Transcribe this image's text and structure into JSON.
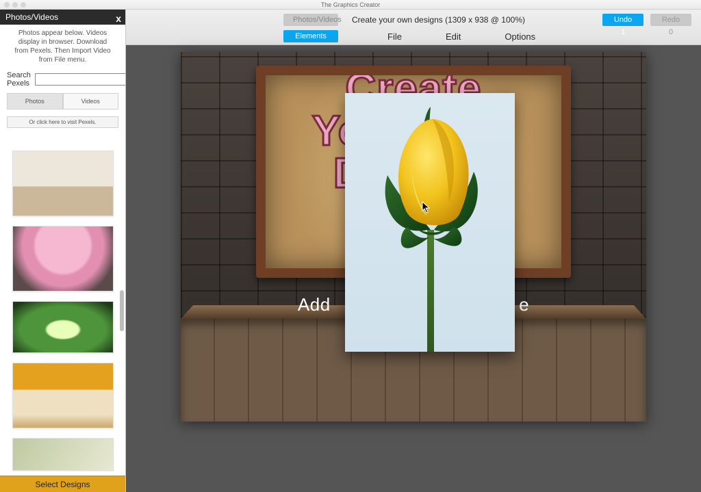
{
  "window": {
    "app_title": "The Graphics Creator"
  },
  "toolbar": {
    "photos_videos_btn": "Photos/Videos",
    "elements_btn": "Elements",
    "doc_title": "Create your own designs (1309 x 938 @ 100%)",
    "undo": "Undo 1",
    "redo": "Redo 0",
    "menus": {
      "file": "File",
      "edit": "Edit",
      "options": "Options"
    }
  },
  "sidebar": {
    "title": "Photos/Videos",
    "close": "x",
    "info": "Photos appear below. Videos display in browser. Download from Pexels. Then Import Video from File menu.",
    "search_label": "Search Pexels",
    "search_value": "",
    "tabs": {
      "photos": "Photos",
      "videos": "Videos"
    },
    "pexels_link": "Or click here to visit Pexels.",
    "select_designs": "Select Designs"
  },
  "design": {
    "title_line1": "Create",
    "title_line2": "Your Own",
    "title_line3": "Design!",
    "subtitle_left": "Add",
    "subtitle_right": "e"
  }
}
